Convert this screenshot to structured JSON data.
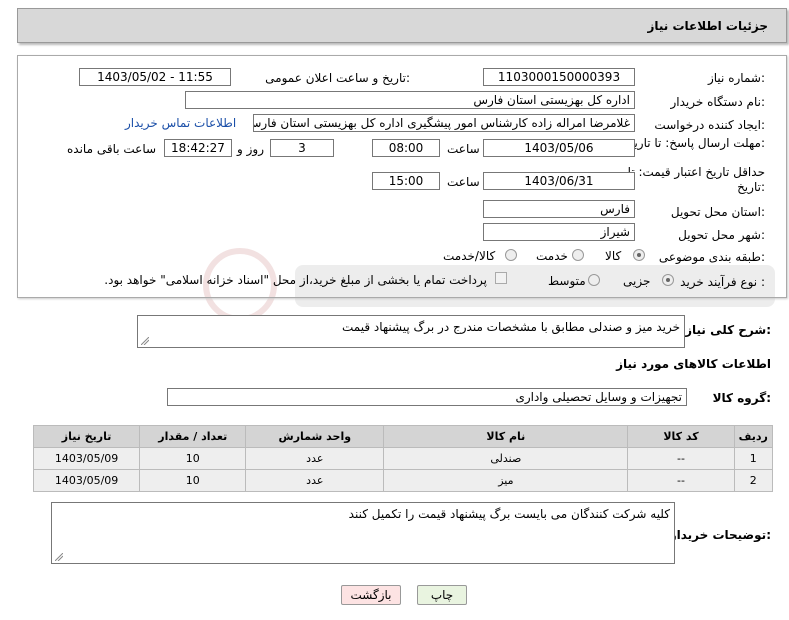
{
  "header": {
    "title": "جزئیات اطلاعات نیاز"
  },
  "form": {
    "need_number_label": "شماره نیاز:",
    "need_number": "1103000150000393",
    "announce_label": "تاریخ و ساعت اعلان عمومی:",
    "announce_value": "1403/05/02 - 11:55",
    "buyer_org_label": "نام دستگاه خریدار:",
    "buyer_org": "اداره کل بهزیستی استان فارس",
    "creator_label": "ایجاد کننده درخواست:",
    "creator": "غلامرضا امراله زاده کارشناس امور پیشگیری اداره کل بهزیستی استان فارس",
    "contact_link": "اطلاعات تماس خریدار",
    "deadline_label": "مهلت ارسال پاسخ: تا تاریخ:",
    "deadline_date": "1403/05/06",
    "hour_label": "ساعت",
    "deadline_time": "08:00",
    "days_value": "3",
    "days_label": "روز و",
    "remaining_time": "18:42:27",
    "remaining_label": "ساعت باقی مانده",
    "validity_label": "حداقل تاریخ اعتبار قیمت: تا تاریخ:",
    "validity_date": "1403/06/31",
    "validity_time": "15:00",
    "province_label": "استان محل تحویل:",
    "province": "فارس",
    "city_label": "شهر محل تحویل:",
    "city": "شیراز",
    "category_label": "طبقه بندی موضوعی:",
    "category_options": [
      "کالا",
      "خدمت",
      "کالا/خدمت"
    ],
    "category_selected": "کالا",
    "process_label": "نوع فرآیند خرید :",
    "process_options": [
      "جزیی",
      "متوسط"
    ],
    "process_selected": "جزیی",
    "payment_note": "پرداخت تمام یا بخشی از مبلغ خرید،از محل \"اسناد خزانه اسلامی\" خواهد بود."
  },
  "summary": {
    "label": "شرح کلی نیاز:",
    "value": "خرید میز و صندلی مطابق با مشخصات مندرج در برگ پیشنهاد قیمت"
  },
  "goods_info": {
    "title": "اطلاعات کالاهای مورد نیاز",
    "group_label": "گروه کالا:",
    "group_value": "تجهیزات و وسایل تحصیلی واداری"
  },
  "table": {
    "headers": [
      "ردیف",
      "کد کالا",
      "نام کالا",
      "واحد شمارش",
      "تعداد / مقدار",
      "تاریخ نیاز"
    ],
    "rows": [
      [
        "1",
        "--",
        "صندلی",
        "عدد",
        "10",
        "1403/05/09"
      ],
      [
        "2",
        "--",
        "میز",
        "عدد",
        "10",
        "1403/05/09"
      ]
    ]
  },
  "buyer_notes": {
    "label": "توضیحات خریدار:",
    "value": "کلیه شرکت کنندگان می بایست برگ پیشنهاد قیمت را تکمیل کنند"
  },
  "buttons": {
    "print": "چاپ",
    "back": "بازگشت"
  },
  "colors": {
    "link": "#1b4fa8",
    "back_button_bg": "#fde3e3",
    "print_button_bg": "#e9f4e0",
    "header_bg": "#d8d8d8"
  }
}
